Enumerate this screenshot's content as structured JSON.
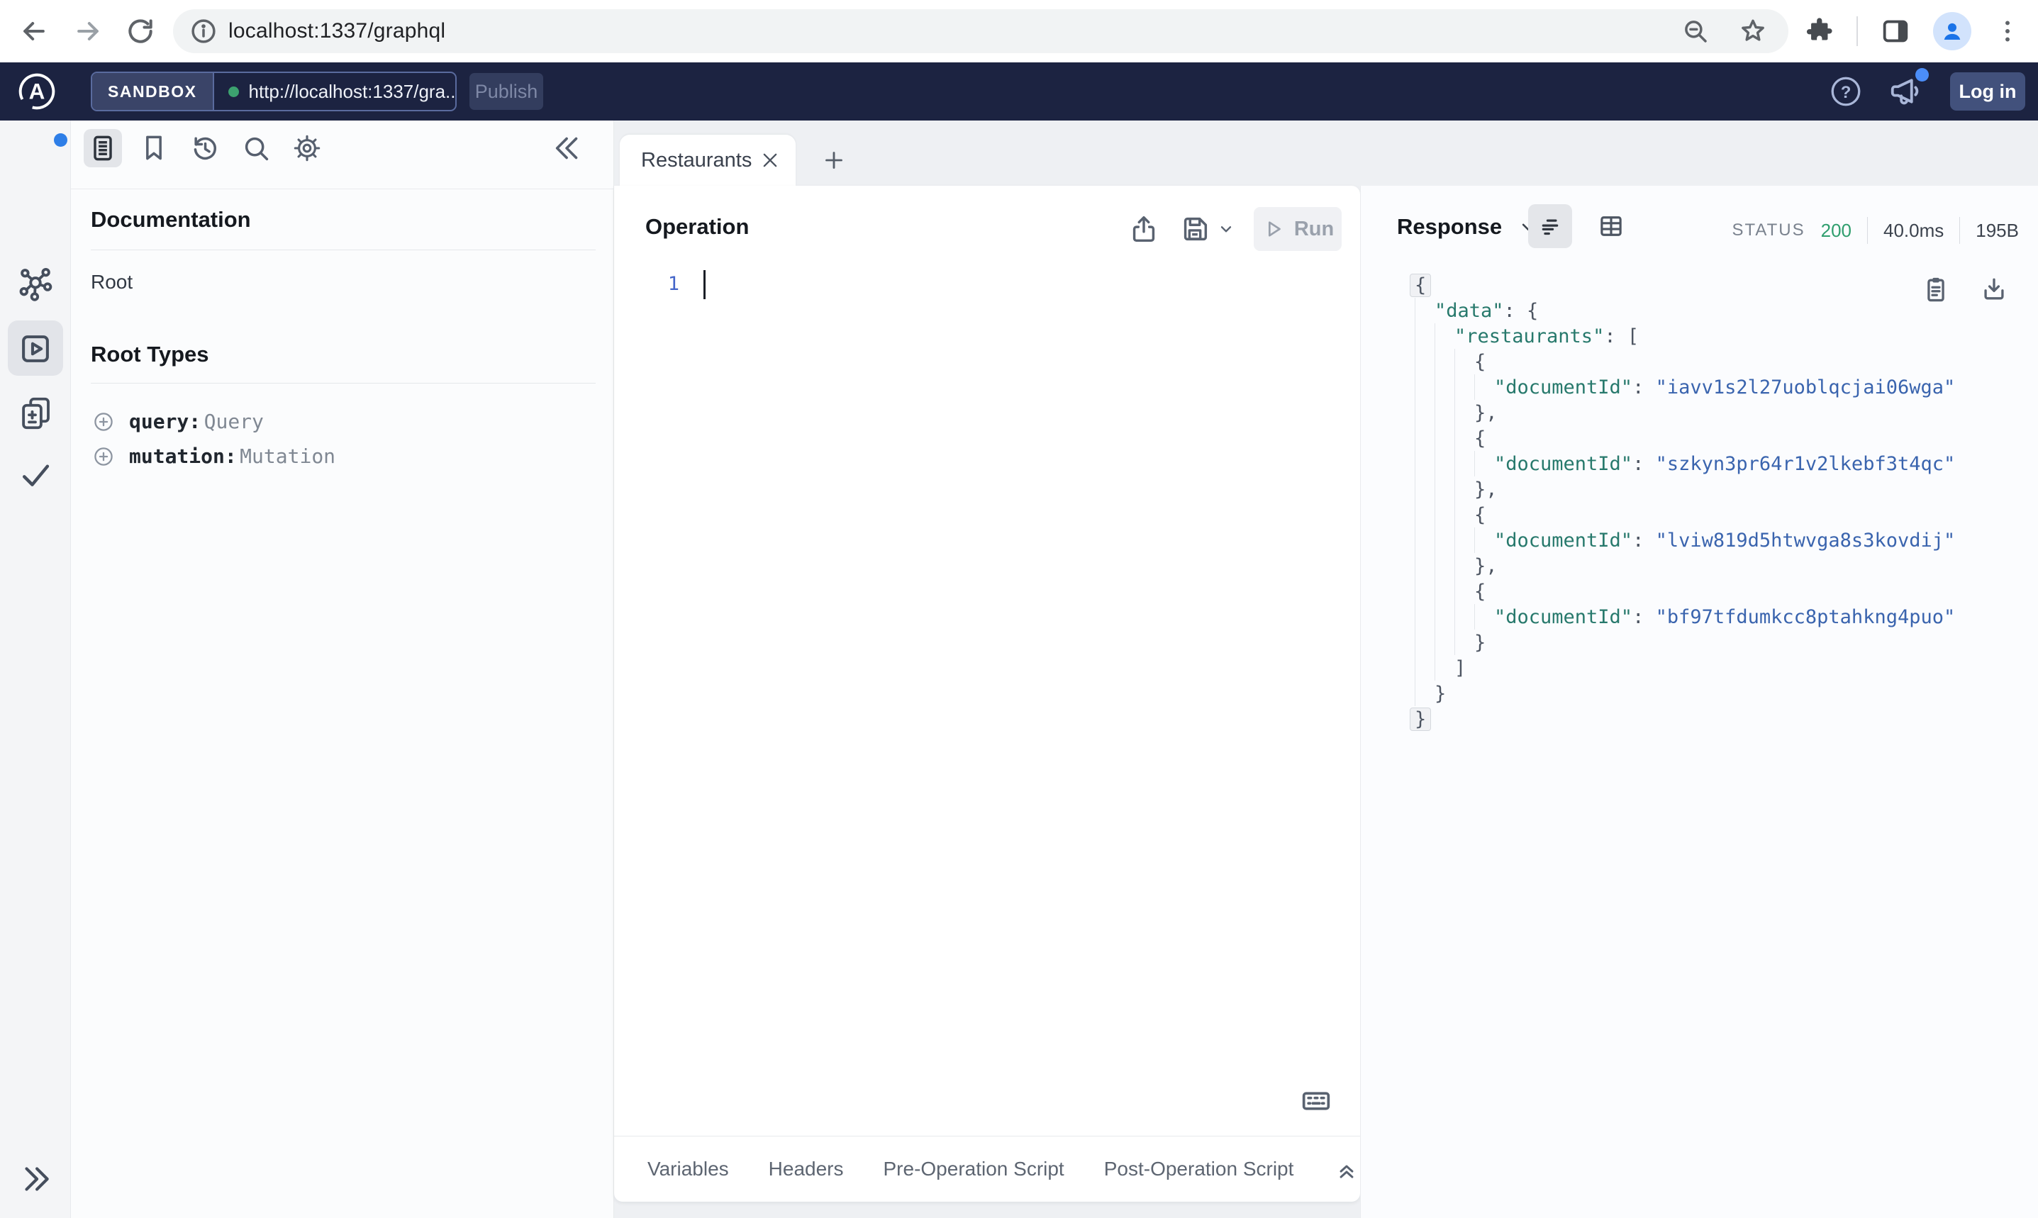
{
  "browser": {
    "url": "localhost:1337/graphql"
  },
  "app_header": {
    "sandbox_label": "SANDBOX",
    "endpoint_url": "http://localhost:1337/gra...",
    "publish_label": "Publish",
    "login_label": "Log in",
    "logo_letter": "A"
  },
  "docs": {
    "title": "Documentation",
    "root_link": "Root",
    "types_title": "Root Types",
    "types": [
      {
        "field": "query:",
        "type": "Query"
      },
      {
        "field": "mutation:",
        "type": "Mutation"
      }
    ]
  },
  "tabs": {
    "active": "Restaurants"
  },
  "operation": {
    "title": "Operation",
    "run_label": "Run",
    "line_number": "1"
  },
  "response": {
    "title": "Response",
    "status_label": "STATUS",
    "status_code": "200",
    "time": "40.0ms",
    "size": "195B",
    "lines": [
      {
        "i": 0,
        "box": true,
        "t": [
          [
            "p",
            "{"
          ]
        ]
      },
      {
        "i": 1,
        "t": [
          [
            "k",
            "\"data\""
          ],
          [
            "p",
            ": {"
          ]
        ]
      },
      {
        "i": 2,
        "t": [
          [
            "k",
            "\"restaurants\""
          ],
          [
            "p",
            ": ["
          ]
        ]
      },
      {
        "i": 3,
        "t": [
          [
            "p",
            "{"
          ]
        ]
      },
      {
        "i": 4,
        "t": [
          [
            "k",
            "\"documentId\""
          ],
          [
            "p",
            ": "
          ],
          [
            "s",
            "\"iavv1s2l27uoblqcjai06wga\""
          ]
        ]
      },
      {
        "i": 3,
        "t": [
          [
            "p",
            "},"
          ]
        ]
      },
      {
        "i": 3,
        "t": [
          [
            "p",
            "{"
          ]
        ]
      },
      {
        "i": 4,
        "t": [
          [
            "k",
            "\"documentId\""
          ],
          [
            "p",
            ": "
          ],
          [
            "s",
            "\"szkyn3pr64r1v2lkebf3t4qc\""
          ]
        ]
      },
      {
        "i": 3,
        "t": [
          [
            "p",
            "},"
          ]
        ]
      },
      {
        "i": 3,
        "t": [
          [
            "p",
            "{"
          ]
        ]
      },
      {
        "i": 4,
        "t": [
          [
            "k",
            "\"documentId\""
          ],
          [
            "p",
            ": "
          ],
          [
            "s",
            "\"lviw819d5htwvga8s3kovdij\""
          ]
        ]
      },
      {
        "i": 3,
        "t": [
          [
            "p",
            "},"
          ]
        ]
      },
      {
        "i": 3,
        "t": [
          [
            "p",
            "{"
          ]
        ]
      },
      {
        "i": 4,
        "t": [
          [
            "k",
            "\"documentId\""
          ],
          [
            "p",
            ": "
          ],
          [
            "s",
            "\"bf97tfdumkcc8ptahkng4puo\""
          ]
        ]
      },
      {
        "i": 3,
        "t": [
          [
            "p",
            "}"
          ]
        ]
      },
      {
        "i": 2,
        "t": [
          [
            "p",
            "]"
          ]
        ]
      },
      {
        "i": 1,
        "t": [
          [
            "p",
            "}"
          ]
        ]
      },
      {
        "i": 0,
        "box": true,
        "t": [
          [
            "p",
            "}"
          ]
        ]
      }
    ]
  },
  "footer_tabs": [
    "Variables",
    "Headers",
    "Pre-Operation Script",
    "Post-Operation Script"
  ],
  "colors": {
    "header_dark": "#1c2341",
    "status_green": "#2f9e6e",
    "json_key_teal": "#27796c",
    "json_string_blue": "#3a64ae"
  }
}
